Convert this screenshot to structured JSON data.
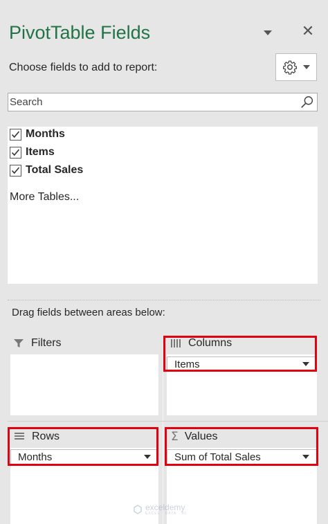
{
  "pane": {
    "title": "PivotTable Fields",
    "choose_label": "Choose fields to add to report:",
    "search_placeholder": "Search",
    "accent_color": "#217346",
    "highlight_color": "#e3000f"
  },
  "fields": [
    {
      "label": "Months",
      "checked": true
    },
    {
      "label": "Items",
      "checked": true
    },
    {
      "label": "Total Sales",
      "checked": true
    }
  ],
  "more_tables_label": "More Tables...",
  "areas": {
    "drag_label": "Drag fields between areas below:",
    "filters": {
      "label": "Filters",
      "icon": "filter-icon"
    },
    "columns": {
      "label": "Columns",
      "icon": "columns-icon",
      "field": "Items"
    },
    "rows": {
      "label": "Rows",
      "icon": "rows-icon",
      "field": "Months"
    },
    "values": {
      "label": "Values",
      "icon": "sigma-icon",
      "field": "Sum of Total Sales"
    }
  },
  "watermark": {
    "name": "exceldemy",
    "tagline": "EXCEL · DATA · BI"
  }
}
